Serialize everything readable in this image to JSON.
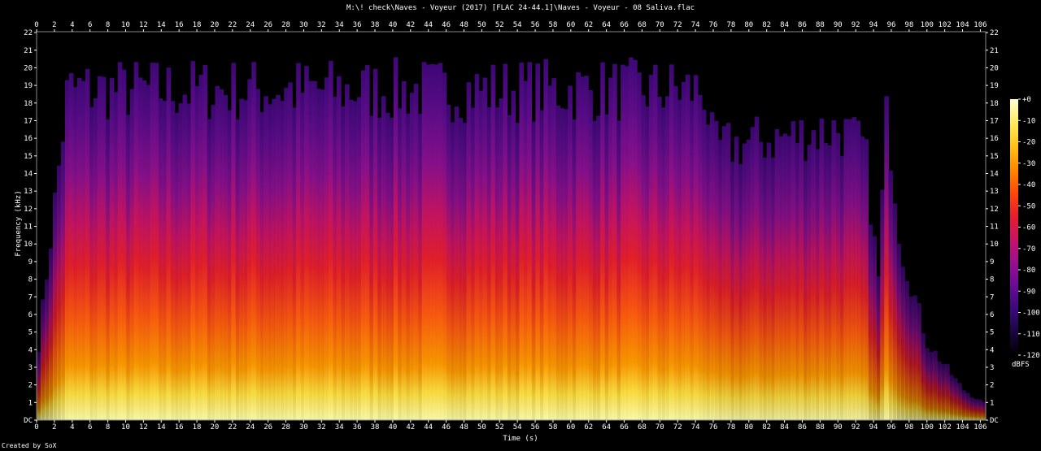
{
  "chart_data": {
    "type": "heatmap",
    "title": "M:\\! check\\Naves - Voyeur (2017) [FLAC 24-44.1]\\Naves - Voyeur - 08 Saliva.flac",
    "xlabel": "Time (s)",
    "ylabel": "Frequency (kHz)",
    "xlim": [
      0,
      106.6
    ],
    "ylim": [
      0,
      22.05
    ],
    "x_ticks": [
      "0",
      "2",
      "4",
      "6",
      "8",
      "10",
      "12",
      "14",
      "16",
      "18",
      "20",
      "22",
      "24",
      "26",
      "28",
      "30",
      "32",
      "34",
      "36",
      "38",
      "40",
      "42",
      "44",
      "46",
      "48",
      "50",
      "52",
      "54",
      "56",
      "58",
      "60",
      "62",
      "64",
      "66",
      "68",
      "70",
      "72",
      "74",
      "76",
      "78",
      "80",
      "82",
      "84",
      "86",
      "88",
      "90",
      "92",
      "94",
      "96",
      "98",
      "100",
      "102",
      "104",
      "106"
    ],
    "y_ticks": [
      "DC",
      "1",
      "2",
      "3",
      "4",
      "5",
      "6",
      "7",
      "8",
      "9",
      "10",
      "11",
      "12",
      "13",
      "14",
      "15",
      "16",
      "17",
      "18",
      "19",
      "20",
      "21",
      "22"
    ],
    "colorbar": {
      "label": "dBFS",
      "ticks": [
        "+0",
        "-10",
        "-20",
        "-30",
        "-40",
        "-50",
        "-60",
        "-70",
        "-80",
        "-90",
        "-100",
        "-110",
        "-120"
      ],
      "range": [
        -120,
        0
      ],
      "colors": [
        "#000000",
        "#1a0640",
        "#3b0a7a",
        "#6a0c96",
        "#9a0f8e",
        "#c81464",
        "#e81e2a",
        "#ff4a0a",
        "#ff8a00",
        "#ffc21a",
        "#ffec60",
        "#ffffd8"
      ]
    },
    "credit": "Created by SoX",
    "energy_profile": [
      {
        "time": 0,
        "level": 0.15
      },
      {
        "time": 1.5,
        "level": 0.45
      },
      {
        "time": 3.5,
        "level": 0.85
      },
      {
        "time": 75,
        "level": 0.85
      },
      {
        "time": 76,
        "level": 0.7
      },
      {
        "time": 90,
        "level": 0.75
      },
      {
        "time": 93,
        "level": 0.7
      },
      {
        "time": 94.5,
        "level": 0.35
      },
      {
        "time": 95.5,
        "level": 0.8
      },
      {
        "time": 97,
        "level": 0.45
      },
      {
        "time": 100,
        "level": 0.2
      },
      {
        "time": 104,
        "level": 0.08
      },
      {
        "time": 106.6,
        "level": 0.04
      }
    ]
  }
}
